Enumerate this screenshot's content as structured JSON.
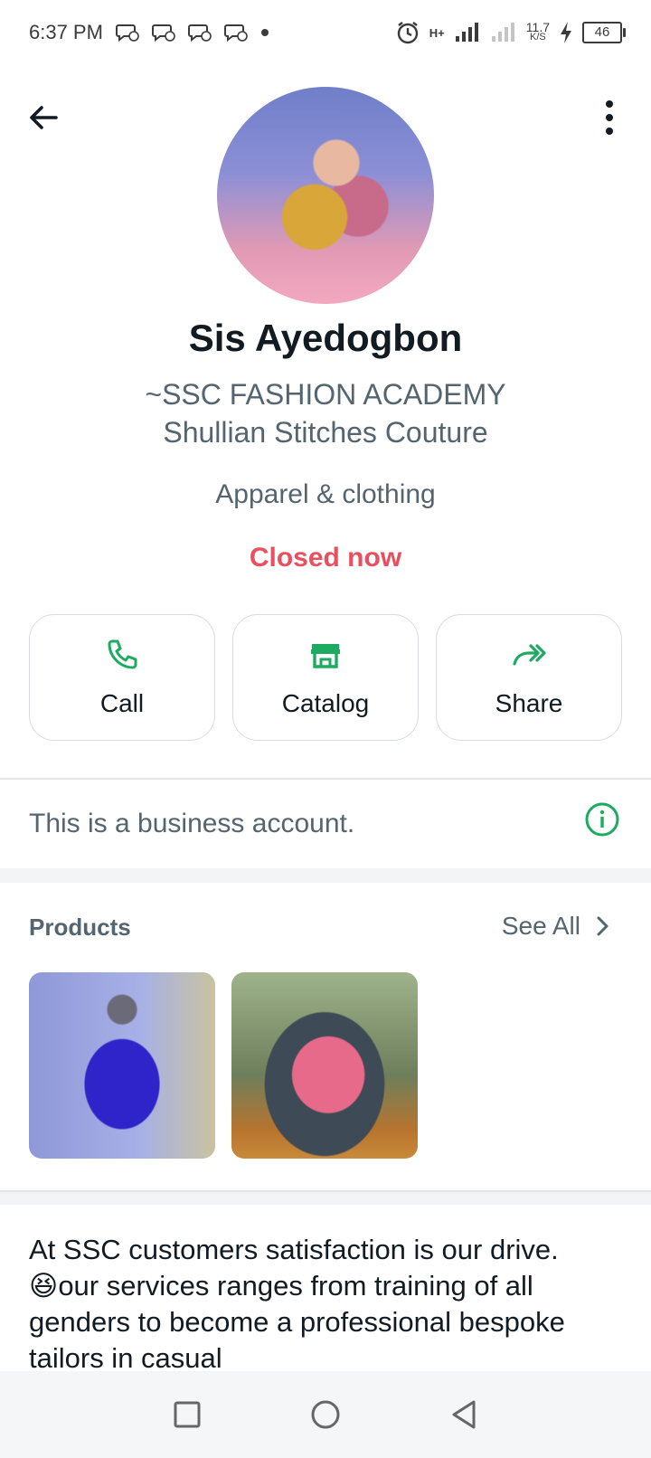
{
  "status_bar": {
    "time": "6:37 PM",
    "network": "H+",
    "speed_value": "11.7",
    "speed_unit": "K/S",
    "battery": "46"
  },
  "profile": {
    "name": "Sis Ayedogbon",
    "subtitle_line1": "~SSC FASHION ACADEMY",
    "subtitle_line2": "Shullian Stitches Couture",
    "category": "Apparel & clothing",
    "hours_status": "Closed now"
  },
  "actions": [
    {
      "label": "Call",
      "icon": "phone-icon"
    },
    {
      "label": "Catalog",
      "icon": "store-icon"
    },
    {
      "label": "Share",
      "icon": "share-icon"
    }
  ],
  "business_note": {
    "text": "This is a business account."
  },
  "products": {
    "heading": "Products",
    "see_all": "See All"
  },
  "about": {
    "text": "At SSC customers satisfaction is our drive. 😆our services ranges from training of all genders to become a professional bespoke tailors in casual"
  },
  "colors": {
    "accent_green": "#1daa61",
    "closed_red": "#ea4f5f",
    "text_secondary": "#54656f"
  }
}
